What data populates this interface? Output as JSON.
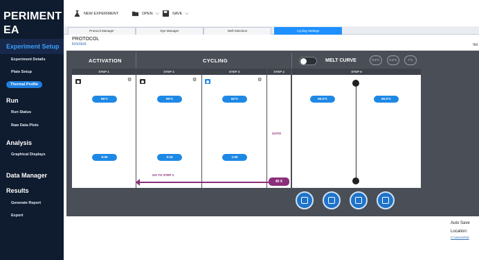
{
  "sidebar": {
    "title_line1": "PERIMENT",
    "title_line2": "EA",
    "sections": [
      {
        "label": "Experiment Setup",
        "items": [
          "Experiment Details",
          "Plate Setup",
          "Thermal Profile"
        ]
      },
      {
        "label": "Run",
        "items": [
          "Run Status",
          "Raw Data Plots"
        ]
      },
      {
        "label": "Analysis",
        "items": [
          "Graphical Displays"
        ]
      },
      {
        "label": "Data Manager",
        "items": []
      },
      {
        "label": "Results",
        "items": [
          "Generate Report",
          "Export"
        ]
      }
    ],
    "active_item": "Thermal Profile"
  },
  "toolbar": {
    "new_label": "NEW EXPERIMENT",
    "open_label": "OPEN",
    "save_label": "SAVE"
  },
  "tabs": [
    "Protocol Manager",
    "Dye Manager",
    "Well Selection",
    "Cycling Settings"
  ],
  "active_tab": "Cycling Settings",
  "protocol": {
    "label": "PROTOCOL",
    "name": "kmctest",
    "vol_label": "Vol"
  },
  "stages": {
    "activation": "ACTIVATION",
    "cycling": "CYCLING",
    "melt_curve": "MELT CURVE",
    "melt_enabled": false
  },
  "circle_buttons": [
    "0.5°C",
    "0.5°C",
    "7°C"
  ],
  "steps": [
    {
      "label": "STEP 1",
      "temp": "95°C",
      "time": "5:00"
    },
    {
      "label": "STEP 2",
      "temp": "95°C",
      "time": "0:15"
    },
    {
      "label": "STEP 3",
      "temp": "62°C",
      "time": "1:00"
    },
    {
      "label": "STEP 4",
      "goto": "GOTO"
    },
    {
      "label": "STEP 5",
      "temp_a": "60.0°C",
      "temp_b": "90.0°C"
    }
  ],
  "goto_step_text": "GO TO STEP 2",
  "loop_count": "40 X",
  "footer": {
    "autosave": "Auto Save",
    "location_label": "Location:",
    "location_path": "C:\\Users\\Pub"
  },
  "colors": {
    "sidebar_bg": "#0f1b2e",
    "accent": "#1e88e5",
    "loop": "#8b2f7a",
    "panel_bg": "#4a4f57"
  }
}
